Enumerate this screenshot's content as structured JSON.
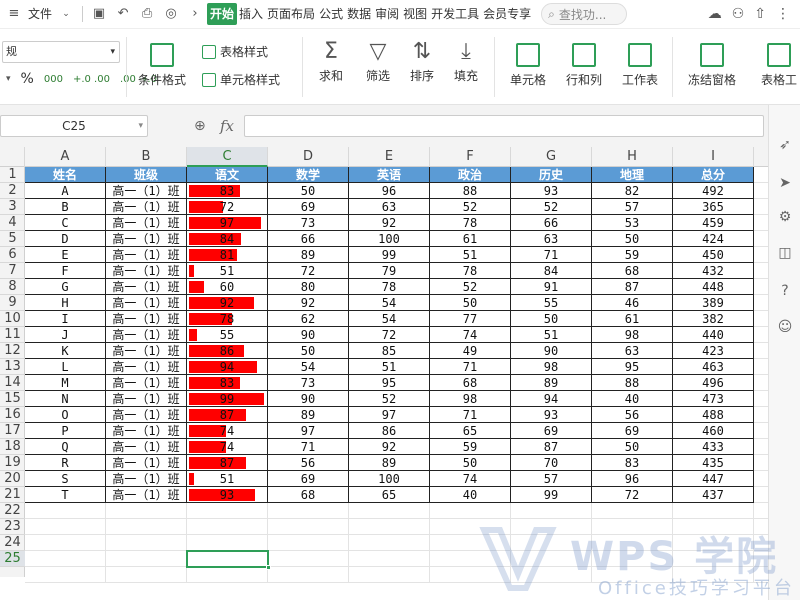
{
  "menubar": {
    "file": "文件",
    "tabs": [
      "开始",
      "插入",
      "页面布局",
      "公式",
      "数据",
      "审阅",
      "视图",
      "开发工具",
      "会员专享"
    ],
    "search_placeholder": "查找功..."
  },
  "ribbon": {
    "font_name": "规",
    "percent": "%",
    "thousands": "000",
    "dec_up": "+.0 .00",
    "dec_down": ".00 →.0",
    "conditional_format": "条件格式",
    "table_style": "表格样式",
    "cell_style": "单元格样式",
    "sum": "求和",
    "filter": "筛选",
    "sort": "排序",
    "fill": "填充",
    "cell": "单元格",
    "rows_cols": "行和列",
    "worksheet": "工作表",
    "freeze": "冻结窗格",
    "table_tool": "表格工"
  },
  "formula_bar": {
    "name_box": "C25",
    "fx": "fx",
    "formula": ""
  },
  "grid": {
    "columns": [
      "A",
      "B",
      "C",
      "D",
      "E",
      "F",
      "G",
      "H",
      "I"
    ],
    "selected_column": "C",
    "selected_row": 25,
    "headers": [
      "姓名",
      "班级",
      "语文",
      "数学",
      "英语",
      "政治",
      "历史",
      "地理",
      "总分"
    ],
    "rows": [
      [
        "A",
        "高一（1）班",
        83,
        50,
        96,
        88,
        93,
        82,
        492
      ],
      [
        "B",
        "高一（1）班",
        72,
        69,
        63,
        52,
        52,
        57,
        365
      ],
      [
        "C",
        "高一（1）班",
        97,
        73,
        92,
        78,
        66,
        53,
        459
      ],
      [
        "D",
        "高一（1）班",
        84,
        66,
        100,
        61,
        63,
        50,
        424
      ],
      [
        "E",
        "高一（1）班",
        81,
        89,
        99,
        51,
        71,
        59,
        450
      ],
      [
        "F",
        "高一（1）班",
        51,
        72,
        79,
        78,
        84,
        68,
        432
      ],
      [
        "G",
        "高一（1）班",
        60,
        80,
        78,
        52,
        91,
        87,
        448
      ],
      [
        "H",
        "高一（1）班",
        92,
        92,
        54,
        50,
        55,
        46,
        389
      ],
      [
        "I",
        "高一（1）班",
        78,
        62,
        54,
        77,
        50,
        61,
        382
      ],
      [
        "J",
        "高一（1）班",
        55,
        90,
        72,
        74,
        51,
        98,
        440
      ],
      [
        "K",
        "高一（1）班",
        86,
        50,
        85,
        49,
        90,
        63,
        423
      ],
      [
        "L",
        "高一（1）班",
        94,
        54,
        51,
        71,
        98,
        95,
        463
      ],
      [
        "M",
        "高一（1）班",
        83,
        73,
        95,
        68,
        89,
        88,
        496
      ],
      [
        "N",
        "高一（1）班",
        99,
        90,
        52,
        98,
        94,
        40,
        473
      ],
      [
        "O",
        "高一（1）班",
        87,
        89,
        97,
        71,
        93,
        56,
        488
      ],
      [
        "P",
        "高一（1）班",
        74,
        97,
        86,
        65,
        69,
        69,
        460
      ],
      [
        "Q",
        "高一（1）班",
        74,
        71,
        92,
        59,
        87,
        50,
        433
      ],
      [
        "R",
        "高一（1）班",
        87,
        56,
        89,
        50,
        70,
        83,
        435
      ],
      [
        "S",
        "高一（1）班",
        51,
        69,
        100,
        74,
        57,
        96,
        447
      ],
      [
        "T",
        "高一（1）班",
        93,
        68,
        65,
        40,
        99,
        72,
        437
      ]
    ],
    "bar_range": [
      50,
      100
    ],
    "bar_color": "#ff0000",
    "header_color": "#5b9bd5",
    "row_count": 25
  },
  "watermark": {
    "title": "WPS 学院",
    "subtitle": "Office技巧学习平台"
  }
}
